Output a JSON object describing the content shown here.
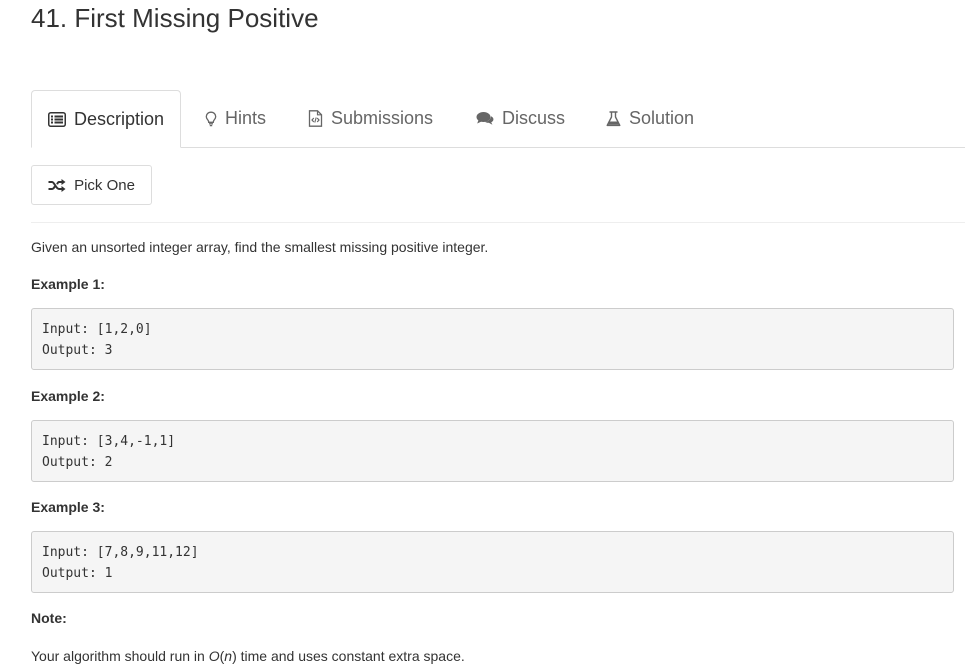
{
  "problem": {
    "title": "41. First Missing Positive"
  },
  "tabs": [
    {
      "label": "Description",
      "icon": "list-icon"
    },
    {
      "label": "Hints",
      "icon": "lightbulb-icon"
    },
    {
      "label": "Submissions",
      "icon": "file-code-icon"
    },
    {
      "label": "Discuss",
      "icon": "comments-icon"
    },
    {
      "label": "Solution",
      "icon": "flask-icon"
    }
  ],
  "pick_button": {
    "label": "Pick One",
    "icon": "shuffle-icon"
  },
  "description": {
    "intro": "Given an unsorted integer array, find the smallest missing positive integer.",
    "examples": [
      {
        "heading": "Example 1:",
        "input": "Input: [1,2,0]",
        "output": "Output: 3"
      },
      {
        "heading": "Example 2:",
        "input": "Input: [3,4,-1,1]",
        "output": "Output: 2"
      },
      {
        "heading": "Example 3:",
        "input": "Input: [7,8,9,11,12]",
        "output": "Output: 1"
      }
    ],
    "note_heading": "Note:",
    "note_prefix": "Your algorithm should run in ",
    "note_o": "O",
    "note_paren_open": "(",
    "note_n": "n",
    "note_paren_close": ")",
    "note_suffix": " time and uses constant extra space."
  },
  "colors": {
    "text": "#333333",
    "muted_tab": "#666666",
    "border": "#dddddd",
    "code_bg": "#f5f5f5"
  }
}
